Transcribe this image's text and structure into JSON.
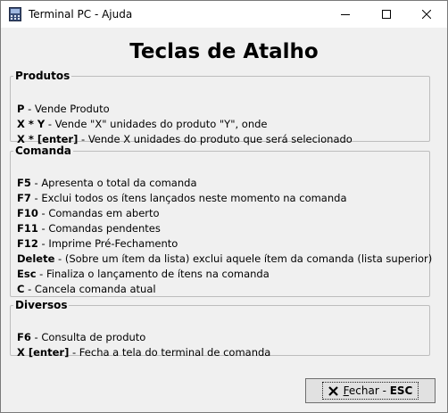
{
  "window": {
    "title": "Terminal PC - Ajuda"
  },
  "heading": "Teclas de Atalho",
  "groups": [
    {
      "label": "Produtos",
      "items": [
        {
          "key": "P",
          "desc": " - Vende Produto"
        },
        {
          "key": "X * Y",
          "desc": " - Vende \"X\" unidades do produto \"Y\", onde"
        },
        {
          "key": "X * [enter]",
          "desc": " - Vende X unidades do produto que será selecionado"
        }
      ]
    },
    {
      "label": "Comanda",
      "items": [
        {
          "key": "F5",
          "desc": " - Apresenta o total da comanda"
        },
        {
          "key": "F7",
          "desc": " - Exclui todos os ítens lançados neste momento na comanda"
        },
        {
          "key": "F10",
          "desc": " - Comandas em aberto"
        },
        {
          "key": "F11",
          "desc": " - Comandas pendentes"
        },
        {
          "key": "F12",
          "desc": " - Imprime Pré-Fechamento"
        },
        {
          "key": "Delete",
          "desc": " - (Sobre um ítem da lista) exclui aquele ítem da comanda (lista superior)"
        },
        {
          "key": "Esc",
          "desc": " - Finaliza o lançamento de ítens na comanda"
        },
        {
          "key": "C",
          "desc": " - Cancela comanda atual"
        }
      ]
    },
    {
      "label": "Diversos",
      "items": [
        {
          "key": "F6",
          "desc": " - Consulta de produto"
        },
        {
          "key": "X [enter]",
          "desc": " - Fecha a tela do terminal de comanda"
        }
      ]
    }
  ],
  "close_button": {
    "label_first": "F",
    "label_rest": "echar",
    "separator": " - ",
    "shortcut": "ESC"
  }
}
